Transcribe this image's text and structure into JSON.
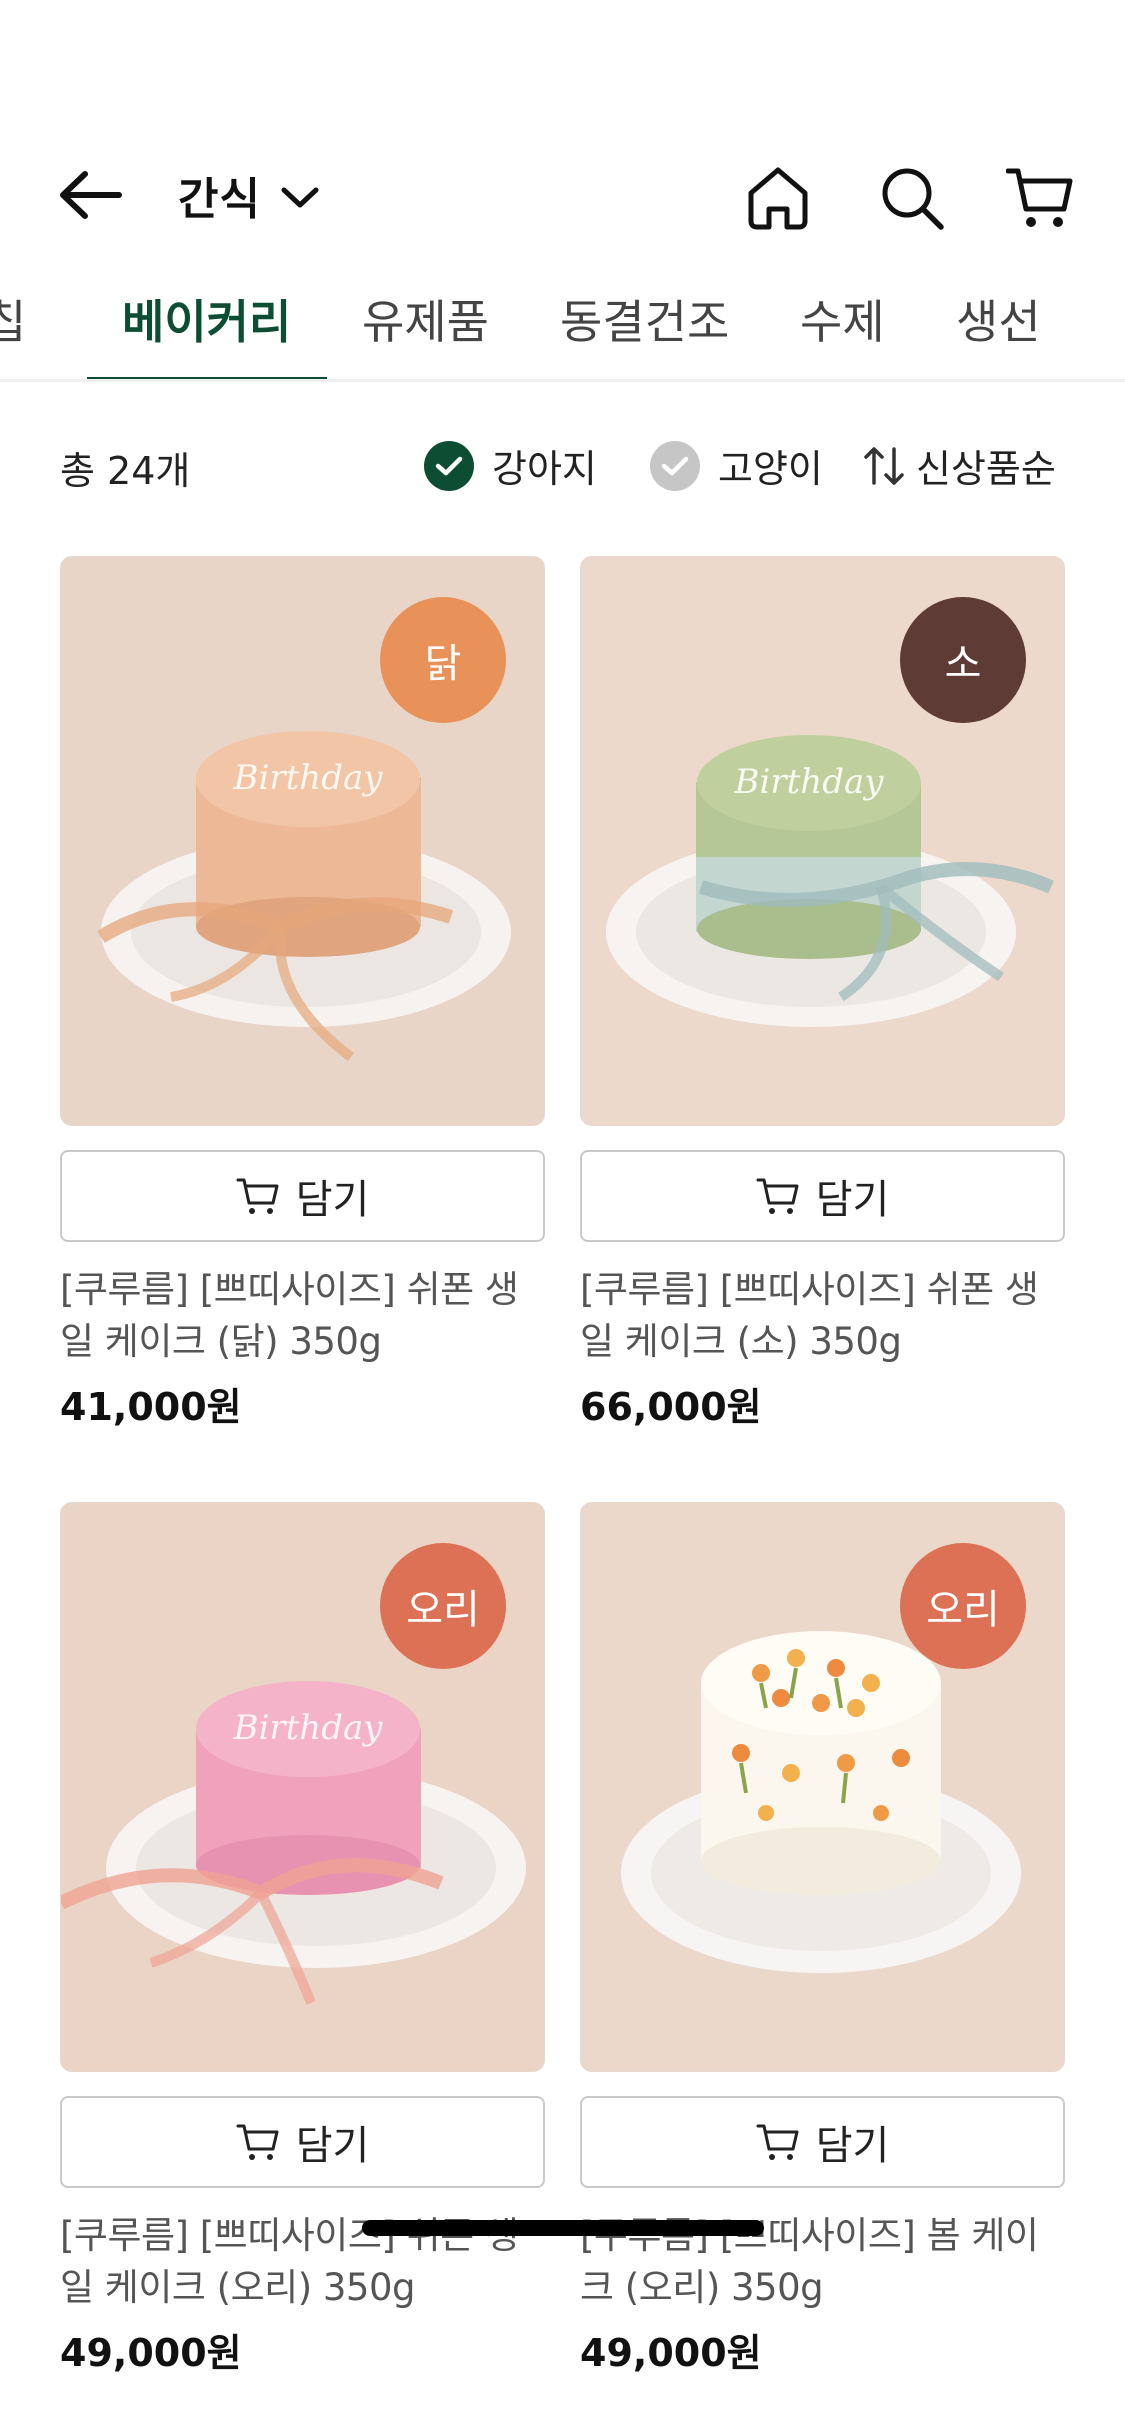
{
  "header": {
    "title": "간식"
  },
  "tabs": [
    {
      "label": "칩"
    },
    {
      "label": "베이커리"
    },
    {
      "label": "유제품"
    },
    {
      "label": "동결건조"
    },
    {
      "label": "수제"
    },
    {
      "label": "생선"
    }
  ],
  "filters": {
    "total": "총 24개",
    "dog_label": "강아지",
    "cat_label": "고양이",
    "sort_label": "신상품순"
  },
  "products": [
    {
      "badge": "닭",
      "badge_color": "#e8925a",
      "cart_label": "담기",
      "name": "[쿠루름] [쁘띠사이즈] 쉬폰 생일 케이크 (닭) 350g",
      "price": "41,000원"
    },
    {
      "badge": "소",
      "badge_color": "#5e3b35",
      "cart_label": "담기",
      "name": "[쿠루름] [쁘띠사이즈] 쉬폰 생일 케이크 (소) 350g",
      "price": "66,000원"
    },
    {
      "badge": "오리",
      "badge_color": "#dd7155",
      "cart_label": "담기",
      "name": "[쿠루름] [쁘띠사이즈] 쉬폰 생일 케이크 (오리) 350g",
      "price": "49,000원"
    },
    {
      "badge": "오리",
      "badge_color": "#dd7155",
      "cart_label": "담기",
      "name": "[쿠루름] [쁘띠사이즈] 봄 케이크 (오리) 350g",
      "price": "49,000원"
    }
  ],
  "colors": {
    "accent": "#0d4d33"
  }
}
